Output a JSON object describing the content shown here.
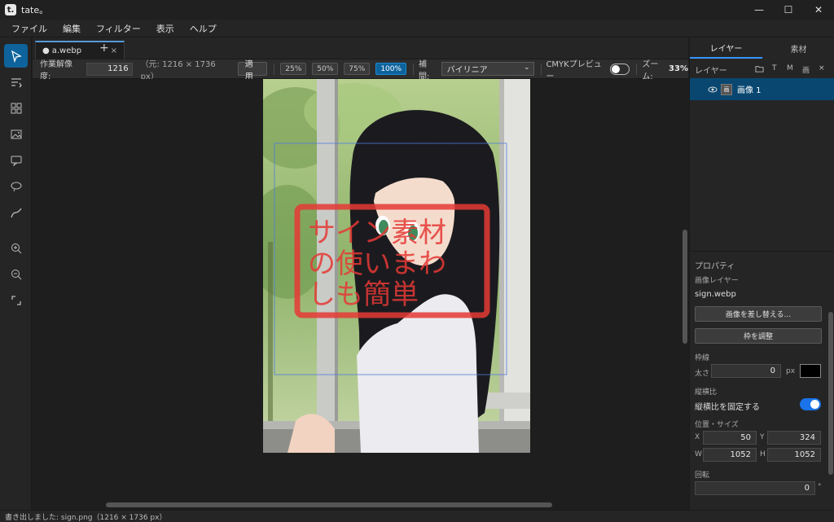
{
  "app": {
    "logo": "t.",
    "title": "tate。"
  },
  "window_controls": {
    "minimize": "—",
    "maximize": "☐",
    "close": "✕"
  },
  "menu": [
    "ファイル",
    "編集",
    "フィルター",
    "表示",
    "ヘルプ"
  ],
  "tools": [
    "select-icon",
    "text-icon",
    "grid-icon",
    "image-icon",
    "speech-bubble-icon",
    "thought-bubble-icon",
    "curve-icon",
    "zoom-in-icon",
    "zoom-out-icon",
    "fit-icon"
  ],
  "tabs": {
    "active_label": "a.webp",
    "dirty_marker": "●",
    "close": "×",
    "add": "+"
  },
  "options": {
    "resolution_label": "作業解像度:",
    "resolution_value": "1216",
    "original": "（元: 1216 × 1736 px）",
    "apply_label": "適用",
    "zoom_presets": [
      "25%",
      "50%",
      "75%",
      "100%"
    ],
    "active_preset": "100%",
    "interp_label": "補間:",
    "interp_value": "バイリニア",
    "cmyk_label": "CMYKプレビュー",
    "cmyk_on": false,
    "zoom_label": "ズーム:",
    "zoom_value": "33%"
  },
  "canvas": {
    "stamp_lines": [
      "サイン素材",
      "の使いまわ",
      "しも簡単"
    ],
    "stamp_color": "#e53935"
  },
  "right_panel": {
    "tabs": [
      "レイヤー",
      "素材"
    ],
    "active_tab": "レイヤー",
    "layers_label": "レイヤー",
    "layer_actions": [
      "folder-icon",
      "T",
      "M",
      "image-add-icon",
      "×"
    ],
    "layer_actions_text": [
      "T",
      "M",
      "画",
      "×"
    ],
    "layers": [
      {
        "name": "画像 1",
        "thumb": "画",
        "visible": true,
        "selected": true
      }
    ],
    "properties": {
      "title": "プロパティ",
      "type": "画像レイヤー",
      "filename": "sign.webp",
      "replace_label": "画像を差し替える...",
      "adjust_label": "枠を調整",
      "border_label": "枠線",
      "width_label": "太さ",
      "border_width": "0",
      "unit_px": "px",
      "border_color": "#000000",
      "aspect_label": "縦横比",
      "lock_aspect_label": "縦横比を固定する",
      "lock_aspect_on": true,
      "pos_size_label": "位置・サイズ",
      "x_label": "X",
      "x": "50",
      "y_label": "Y",
      "y": "324",
      "w_label": "W",
      "w": "1052",
      "h_label": "H",
      "h": "1052",
      "rotation_label": "回転",
      "rotation": "0",
      "degree": "°"
    }
  },
  "status": "書き出しました: sign.png（1216 × 1736 px）"
}
